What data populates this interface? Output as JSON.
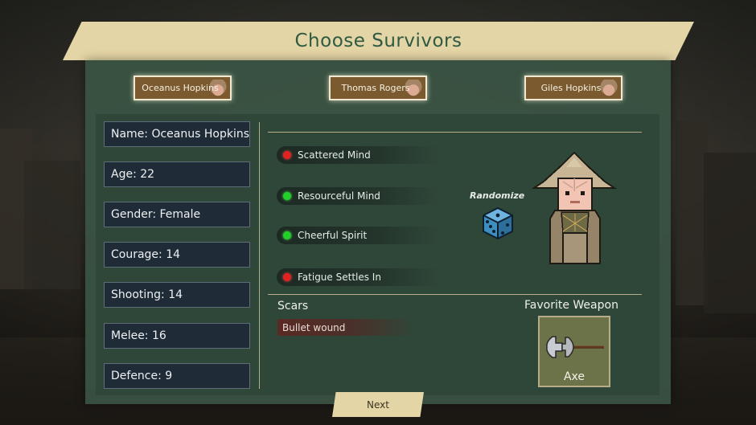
{
  "title": "Choose Survivors",
  "survivor_tabs": [
    {
      "label": "Oceanus Hopkins"
    },
    {
      "label": "Thomas Rogers"
    },
    {
      "label": "Giles Hopkins"
    }
  ],
  "stats": {
    "name": "Name: Oceanus Hopkins",
    "age": "Age: 22",
    "gender": "Gender: Female",
    "courage": "Courage: 14",
    "shooting": "Shooting: 14",
    "melee": "Melee: 16",
    "defence": "Defence: 9"
  },
  "traits": [
    {
      "label": "Scattered Mind",
      "status": "red"
    },
    {
      "label": "Resourceful Mind",
      "status": "green"
    },
    {
      "label": "Cheerful Spirit",
      "status": "green"
    },
    {
      "label": "Fatigue Settles In",
      "status": "red"
    }
  ],
  "randomize_label": "Randomize",
  "scars": {
    "title": "Scars",
    "items": [
      "Bullet wound"
    ]
  },
  "favorite_weapon": {
    "title": "Favorite Weapon",
    "name": "Axe"
  },
  "next_label": "Next",
  "colors": {
    "banner": "#e4d5a6",
    "title_text": "#2e5a42",
    "panel": "#3a5444",
    "trait_red": "#e02222",
    "trait_green": "#22d02a",
    "dice": "#3f8ec0"
  }
}
